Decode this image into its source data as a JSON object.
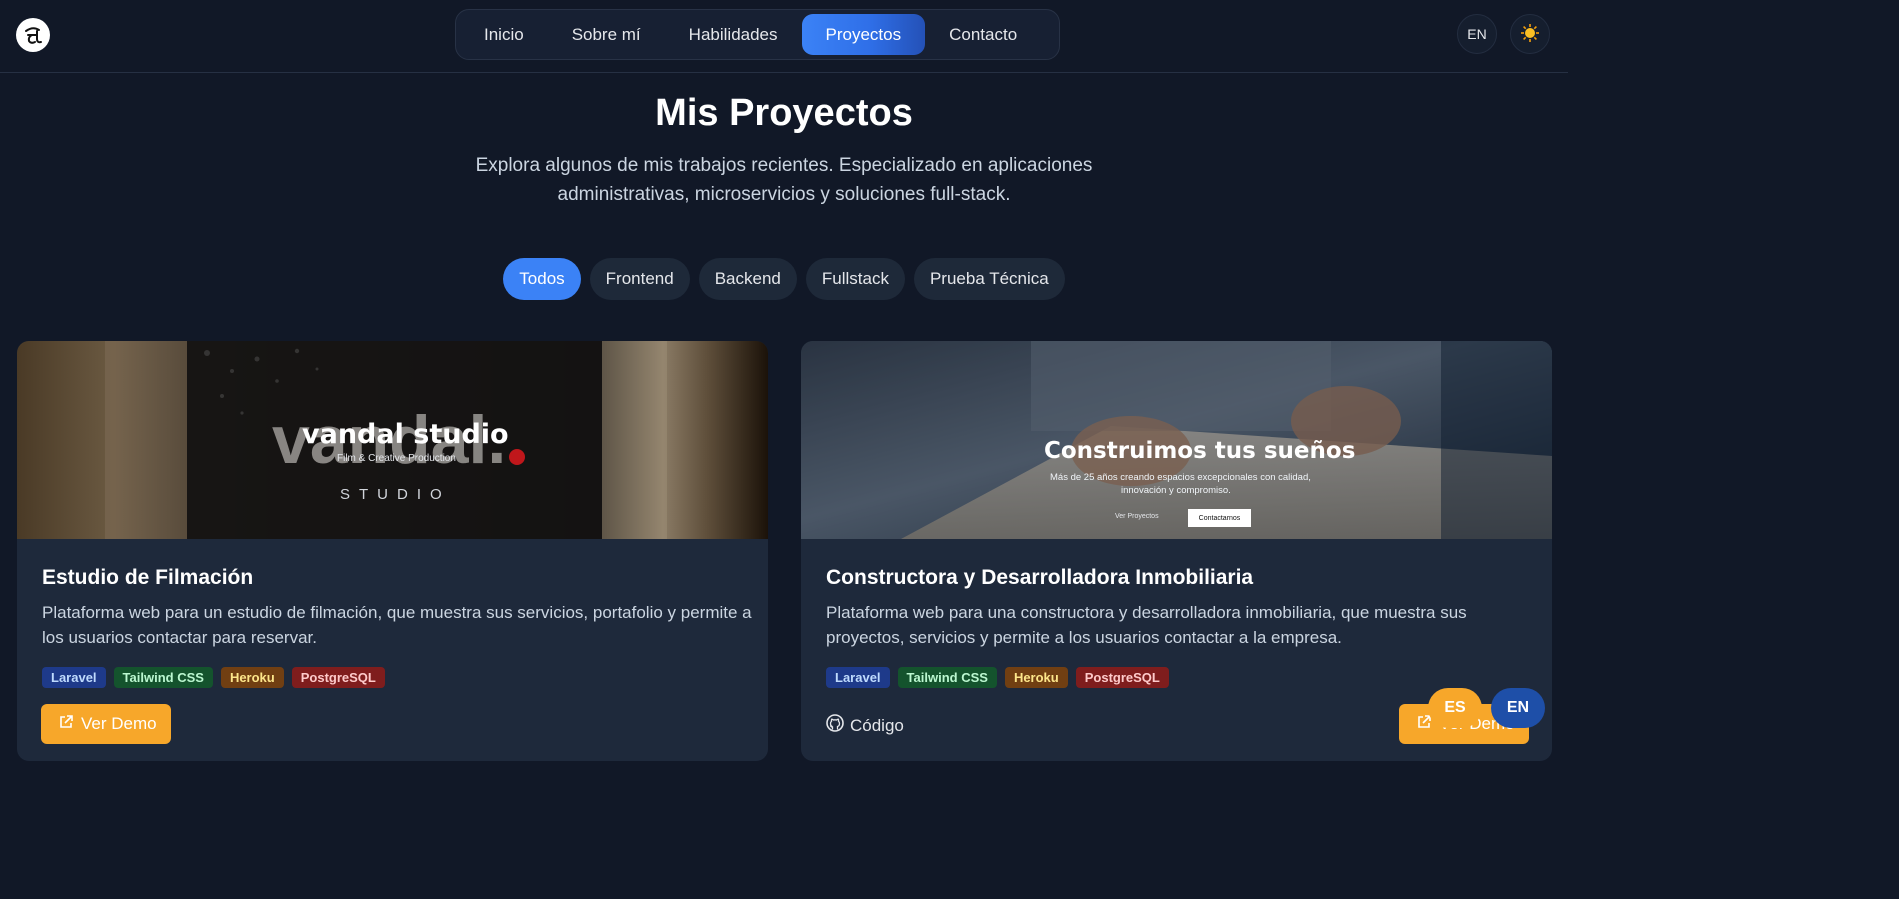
{
  "header": {
    "nav": [
      "Inicio",
      "Sobre mí",
      "Habilidades",
      "Proyectos",
      "Contacto"
    ],
    "active_nav": "Proyectos",
    "lang_button": "EN",
    "theme_icon": "sun-icon",
    "logo_icon": "logo-icon"
  },
  "main": {
    "title": "Mis Proyectos",
    "subtitle": "Explora algunos de mis trabajos recientes. Especializado en aplicaciones administrativas, microservicios y soluciones full-stack.",
    "filters": [
      "Todos",
      "Frontend",
      "Backend",
      "Fullstack",
      "Prueba Técnica"
    ],
    "active_filter": "Todos"
  },
  "projects": [
    {
      "image_text": {
        "headline": "vandal studio",
        "sub": "Film & Creative Production",
        "tagline": "STUDIO"
      },
      "title": "Estudio de Filmación",
      "description": "Plataforma web para un estudio de filmación, que muestra sus servicios, portafolio y permite a los usuarios contactar para reservar.",
      "tags": [
        "Laravel",
        "Tailwind CSS",
        "Heroku",
        "PostgreSQL"
      ],
      "demo_label": "Ver Demo"
    },
    {
      "image_text": {
        "headline": "Construimos tus sueños",
        "sub1": "Más de 25 años creando espacios excepcionales con calidad,",
        "sub2": "innovación y compromiso.",
        "cta1": "Ver Proyectos",
        "cta2": "Contactarnos"
      },
      "title": "Constructora y Desarrolladora Inmobiliaria",
      "description": "Plataforma web para una constructora y desarrolladora inmobiliaria, que muestra sus proyectos, servicios y permite a los usuarios contactar a la empresa.",
      "tags": [
        "Laravel",
        "Tailwind CSS",
        "Heroku",
        "PostgreSQL"
      ],
      "code_label": "Código",
      "demo_label": "Ver Demo"
    }
  ],
  "floating_lang": {
    "es": "ES",
    "en": "EN"
  },
  "colors": {
    "accent": "#3b82f6",
    "demo": "#f7a72a",
    "bg": "#111827",
    "card": "#1e293b"
  }
}
